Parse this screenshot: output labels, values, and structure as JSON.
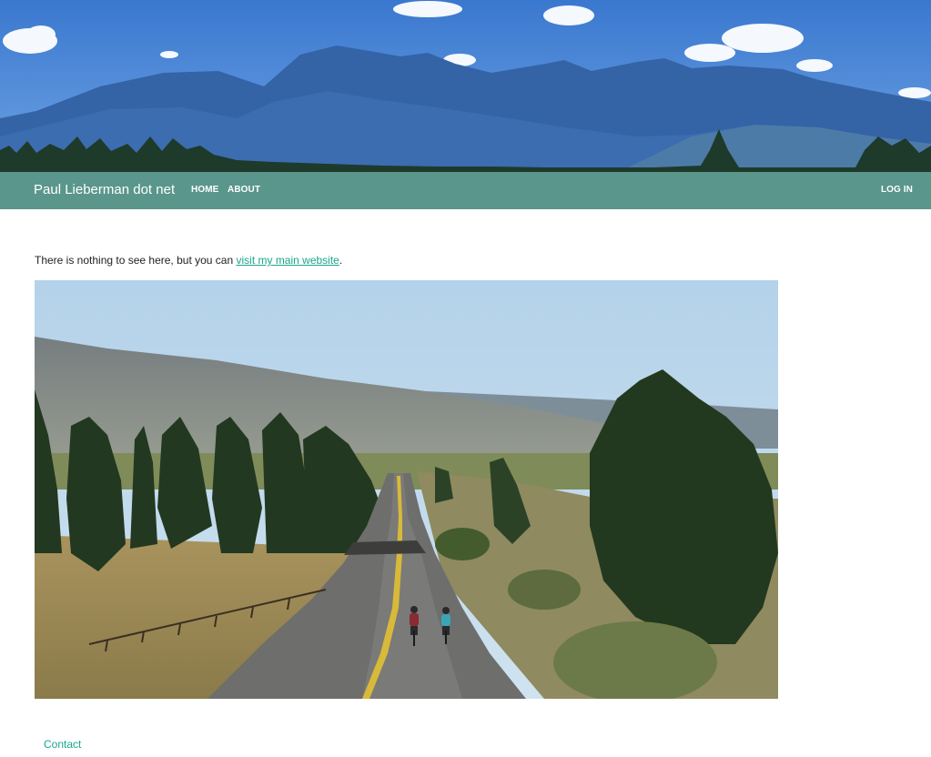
{
  "banner": {
    "image": "mountain-range-banner"
  },
  "navbar": {
    "brand": "Paul Lieberman dot net",
    "links": [
      "HOME",
      "ABOUT"
    ],
    "login": "LOG IN",
    "color": "#5a968c"
  },
  "main": {
    "intro_text": "There is nothing to see here, but you can ",
    "intro_link": "visit my main website",
    "intro_end": ".",
    "photo": "cyclists-on-rural-road",
    "link_color": "#1aa68c"
  },
  "footer": {
    "contact": "Contact"
  }
}
